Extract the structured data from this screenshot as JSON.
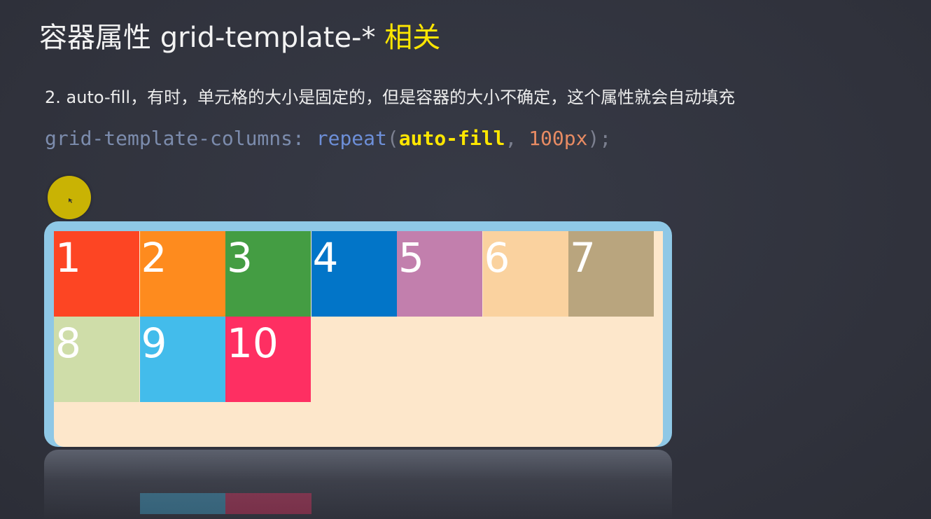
{
  "slide": {
    "title_main": "容器属性  grid-template-* ",
    "title_suffix": "相关",
    "description": "2. auto-fill，有时，单元格的大小是固定的，但是容器的大小不确定，这个属性就会自动填充",
    "code": {
      "property": "grid-template-columns:",
      "function": "repeat",
      "open_paren": "(",
      "keyword": "auto-fill",
      "comma": ",",
      "value": "100px",
      "close": ");"
    }
  },
  "grid": {
    "cells": [
      {
        "label": "1",
        "color": "#fd4523"
      },
      {
        "label": "2",
        "color": "#fe8b1e"
      },
      {
        "label": "3",
        "color": "#449d43"
      },
      {
        "label": "4",
        "color": "#0275c8"
      },
      {
        "label": "5",
        "color": "#c27fad"
      },
      {
        "label": "6",
        "color": "#fad29f"
      },
      {
        "label": "7",
        "color": "#b9a57e"
      },
      {
        "label": "8",
        "color": "#cfdda9"
      },
      {
        "label": "9",
        "color": "#43bceb"
      },
      {
        "label": "10",
        "color": "#fe2f62"
      }
    ],
    "container_border_color": "#8fc8e6",
    "container_bg_color": "#fde7cb"
  },
  "cursor": {
    "highlight_color": "#c9b304",
    "icon": "pointer-icon"
  }
}
